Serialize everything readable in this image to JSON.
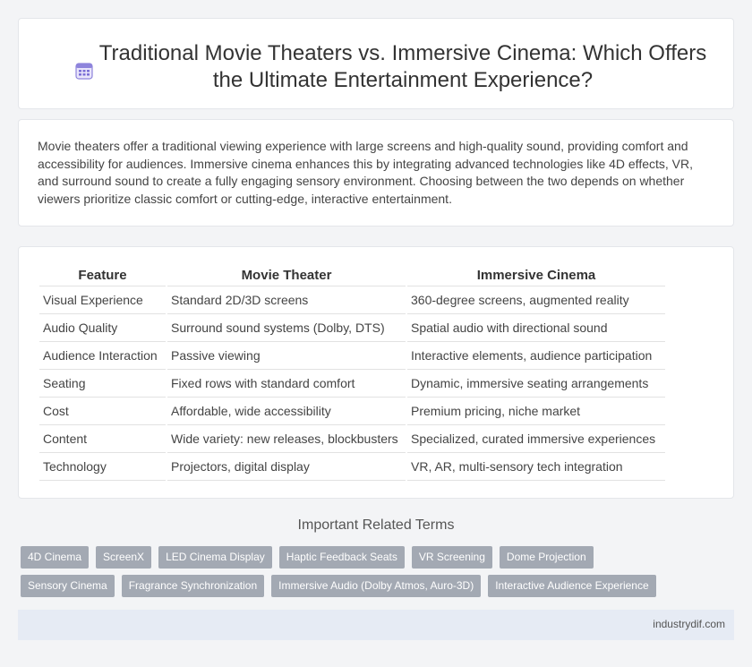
{
  "header": {
    "title": "Traditional Movie Theaters vs. Immersive Cinema: Which Offers the Ultimate Entertainment Experience?",
    "icon": "calendar-icon"
  },
  "intro": {
    "text": "Movie theaters offer a traditional viewing experience with large screens and high-quality sound, providing comfort and accessibility for audiences. Immersive cinema enhances this by integrating advanced technologies like 4D effects, VR, and surround sound to create a fully engaging sensory environment. Choosing between the two depends on whether viewers prioritize classic comfort or cutting-edge, interactive entertainment."
  },
  "table": {
    "headers": [
      "Feature",
      "Movie Theater",
      "Immersive Cinema"
    ],
    "rows": [
      [
        "Visual Experience",
        "Standard 2D/3D screens",
        "360-degree screens, augmented reality"
      ],
      [
        "Audio Quality",
        "Surround sound systems (Dolby, DTS)",
        "Spatial audio with directional sound"
      ],
      [
        "Audience Interaction",
        "Passive viewing",
        "Interactive elements, audience participation"
      ],
      [
        "Seating",
        "Fixed rows with standard comfort",
        "Dynamic, immersive seating arrangements"
      ],
      [
        "Cost",
        "Affordable, wide accessibility",
        "Premium pricing, niche market"
      ],
      [
        "Content",
        "Wide variety: new releases, blockbusters",
        "Specialized, curated immersive experiences"
      ],
      [
        "Technology",
        "Projectors, digital display",
        "VR, AR, multi-sensory tech integration"
      ]
    ]
  },
  "related": {
    "heading": "Important Related Terms",
    "tags": [
      "4D Cinema",
      "ScreenX",
      "LED Cinema Display",
      "Haptic Feedback Seats",
      "VR Screening",
      "Dome Projection",
      "Sensory Cinema",
      "Fragrance Synchronization",
      "Immersive Audio (Dolby Atmos, Auro-3D)",
      "Interactive Audience Experience"
    ]
  },
  "footer": {
    "text": "industrydif.com"
  },
  "colors": {
    "tag_bg": "#a3a9b3",
    "footer_bg": "#e6ebf4",
    "icon": "#7b6fd6"
  }
}
